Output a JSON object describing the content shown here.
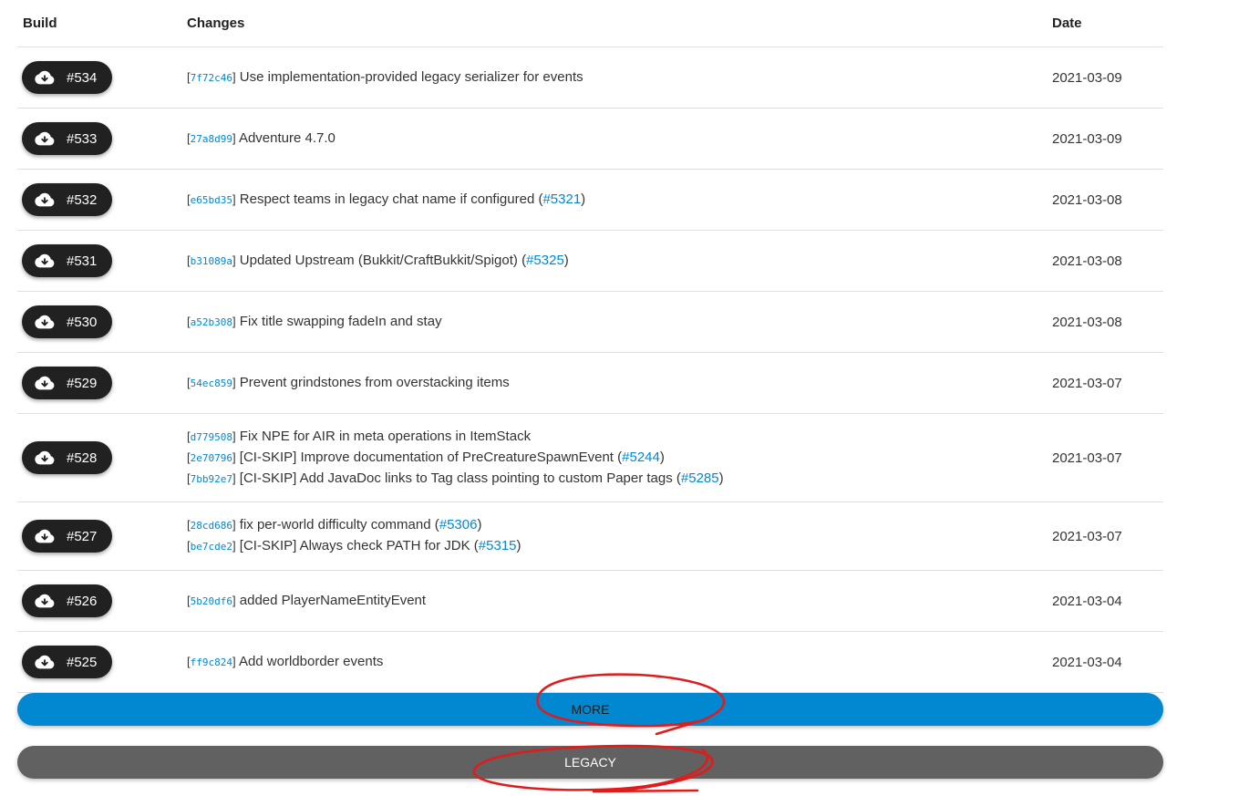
{
  "table": {
    "headers": {
      "build": "Build",
      "changes": "Changes",
      "date": "Date"
    },
    "rows": [
      {
        "build": "#534",
        "date": "2021-03-09",
        "changes": [
          {
            "hash": "7f72c46",
            "text": " Use implementation-provided legacy serializer for events",
            "pr": ""
          }
        ]
      },
      {
        "build": "#533",
        "date": "2021-03-09",
        "changes": [
          {
            "hash": "27a8d99",
            "text": " Adventure 4.7.0",
            "pr": ""
          }
        ]
      },
      {
        "build": "#532",
        "date": "2021-03-08",
        "changes": [
          {
            "hash": "e65bd35",
            "text": " Respect teams in legacy chat name if configured ",
            "pr": "#5321"
          }
        ]
      },
      {
        "build": "#531",
        "date": "2021-03-08",
        "changes": [
          {
            "hash": "b31089a",
            "text": " Updated Upstream (Bukkit/CraftBukkit/Spigot) ",
            "pr": "#5325"
          }
        ]
      },
      {
        "build": "#530",
        "date": "2021-03-08",
        "changes": [
          {
            "hash": "a52b308",
            "text": " Fix title swapping fadeIn and stay",
            "pr": ""
          }
        ]
      },
      {
        "build": "#529",
        "date": "2021-03-07",
        "changes": [
          {
            "hash": "54ec859",
            "text": " Prevent grindstones from overstacking items",
            "pr": ""
          }
        ]
      },
      {
        "build": "#528",
        "date": "2021-03-07",
        "changes": [
          {
            "hash": "d779508",
            "text": " Fix NPE for AIR in meta operations in ItemStack",
            "pr": ""
          },
          {
            "hash": "2e70796",
            "text": " [CI-SKIP] Improve documentation of PreCreatureSpawnEvent ",
            "pr": "#5244"
          },
          {
            "hash": "7bb92e7",
            "text": " [CI-SKIP] Add JavaDoc links to Tag class pointing to custom Paper tags ",
            "pr": "#5285"
          }
        ]
      },
      {
        "build": "#527",
        "date": "2021-03-07",
        "changes": [
          {
            "hash": "28cd686",
            "text": " fix per-world difficulty command ",
            "pr": "#5306"
          },
          {
            "hash": "be7cde2",
            "text": " [CI-SKIP] Always check PATH for JDK ",
            "pr": "#5315"
          }
        ]
      },
      {
        "build": "#526",
        "date": "2021-03-04",
        "changes": [
          {
            "hash": "5b20df6",
            "text": " added PlayerNameEntityEvent",
            "pr": ""
          }
        ]
      },
      {
        "build": "#525",
        "date": "2021-03-04",
        "changes": [
          {
            "hash": "ff9c824",
            "text": " Add worldborder events",
            "pr": ""
          }
        ]
      }
    ]
  },
  "buttons": {
    "more": "MORE",
    "legacy": "LEGACY"
  },
  "colors": {
    "link": "#0288d1",
    "build_button": "#212121",
    "more_button": "#0288d1",
    "legacy_button": "#616161",
    "annotation": "#e01b1b"
  },
  "icons": {
    "download": "cloud-download-icon"
  }
}
